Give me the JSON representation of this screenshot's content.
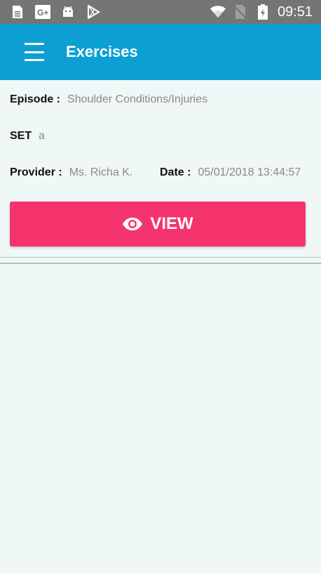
{
  "status_bar": {
    "time": "09:51",
    "icons": [
      "sd-card-icon",
      "google-plus-icon",
      "android-icon",
      "play-store-icon",
      "wifi-icon",
      "no-sim-icon",
      "battery-icon"
    ]
  },
  "app_bar": {
    "title": "Exercises",
    "menu_icon": "hamburger-menu-icon"
  },
  "details": {
    "episode_label": "Episode :",
    "episode_value": "Shoulder Conditions/Injuries",
    "set_label": "SET",
    "set_value": "a",
    "provider_label": "Provider :",
    "provider_value": "Ms. Richa K.",
    "date_label": "Date :",
    "date_value": "05/01/2018 13:44:57"
  },
  "view_button": {
    "label": "VIEW",
    "icon": "eye-icon"
  },
  "colors": {
    "status_bar": "#757575",
    "app_bar": "#0c9fd4",
    "background": "#eff7f7",
    "button": "#f5346d"
  }
}
